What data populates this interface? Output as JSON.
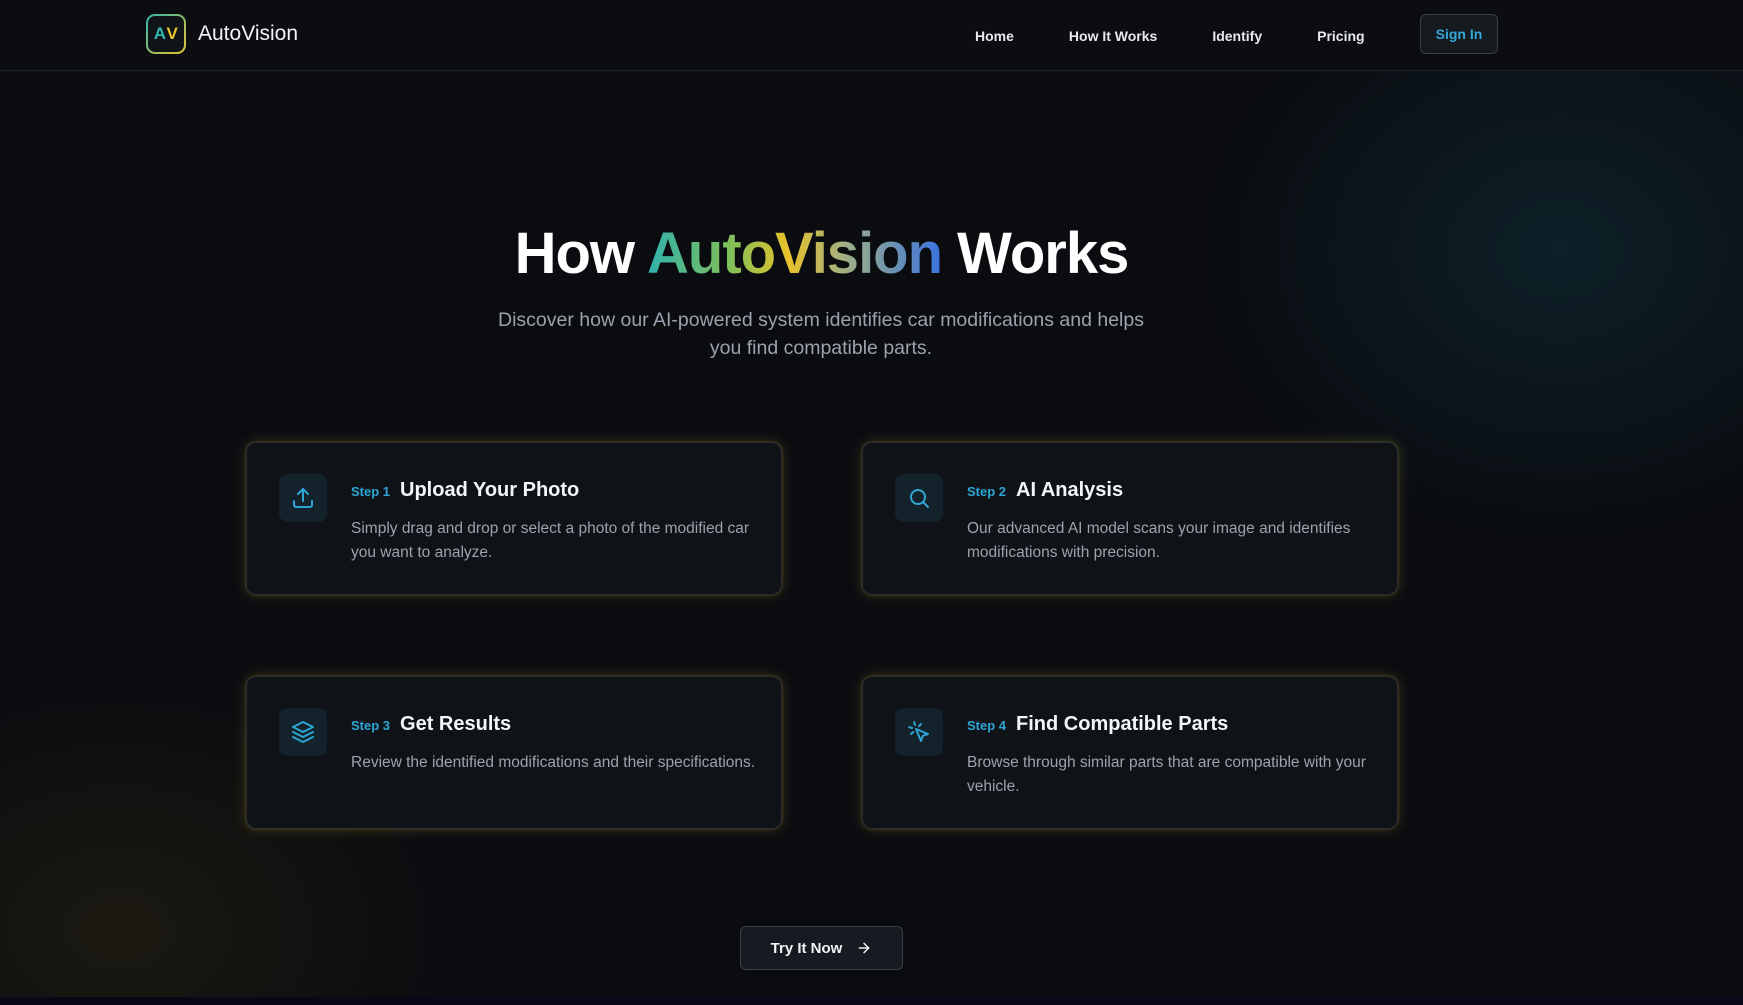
{
  "brand": {
    "logo_letters_a": "A",
    "logo_letters_v": "V",
    "name": "AutoVision"
  },
  "nav": {
    "items": [
      {
        "label": "Home"
      },
      {
        "label": "How It Works"
      },
      {
        "label": "Identify"
      },
      {
        "label": "Pricing"
      }
    ],
    "signin_label": "Sign In"
  },
  "hero": {
    "title_prefix": "How",
    "title_brand": "AutoVision",
    "title_suffix": "Works",
    "subtitle": "Discover how our AI-powered system identifies car modifications and helps you find compatible parts."
  },
  "steps": [
    {
      "step": "Step 1",
      "title": "Upload Your Photo",
      "description": "Simply drag and drop or select a photo of the modified car you want to analyze.",
      "icon": "upload-icon"
    },
    {
      "step": "Step 2",
      "title": "AI Analysis",
      "description": "Our advanced AI model scans your image and identifies modifications with precision.",
      "icon": "search-icon"
    },
    {
      "step": "Step 3",
      "title": "Get Results",
      "description": "Review the identified modifications and their specifications.",
      "icon": "layers-icon"
    },
    {
      "step": "Step 4",
      "title": "Find Compatible Parts",
      "description": "Browse through similar parts that are compatible with your vehicle.",
      "icon": "pointer-click-icon"
    }
  ],
  "cta": {
    "label": "Try It Now",
    "icon": "arrow-right-icon"
  },
  "colors": {
    "background": "#0a0c10",
    "accent_teal": "#2ea6d6",
    "brand_teal": "#2fb3ad",
    "brand_gold": "#e8c22a",
    "brand_blue": "#3a73e0"
  }
}
